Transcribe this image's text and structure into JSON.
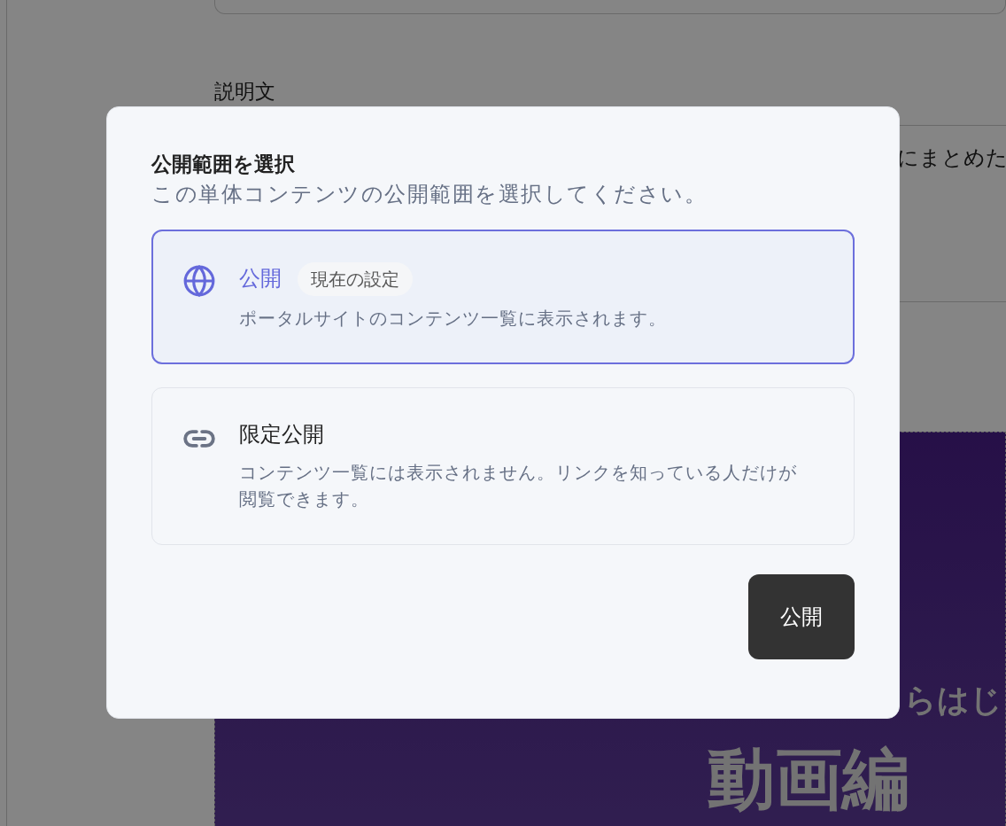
{
  "background": {
    "description_label": "説明文",
    "description_text": "にまとめた",
    "thumbnail_line_1": "らはじ",
    "thumbnail_line_2": "動画編"
  },
  "dialog": {
    "title": "公開範囲を選択",
    "subtitle": "この単体コンテンツの公開範囲を選択してください。",
    "options": [
      {
        "kind": "globe",
        "label": "公開",
        "badge": "現在の設定",
        "description": "ポータルサイトのコンテンツ一覧に表示されます。",
        "selected": true
      },
      {
        "kind": "link",
        "label": "限定公開",
        "description": "コンテンツ一覧には表示されません。リンクを知っている人だけが閲覧できます。",
        "selected": false
      }
    ],
    "button": "公開"
  }
}
